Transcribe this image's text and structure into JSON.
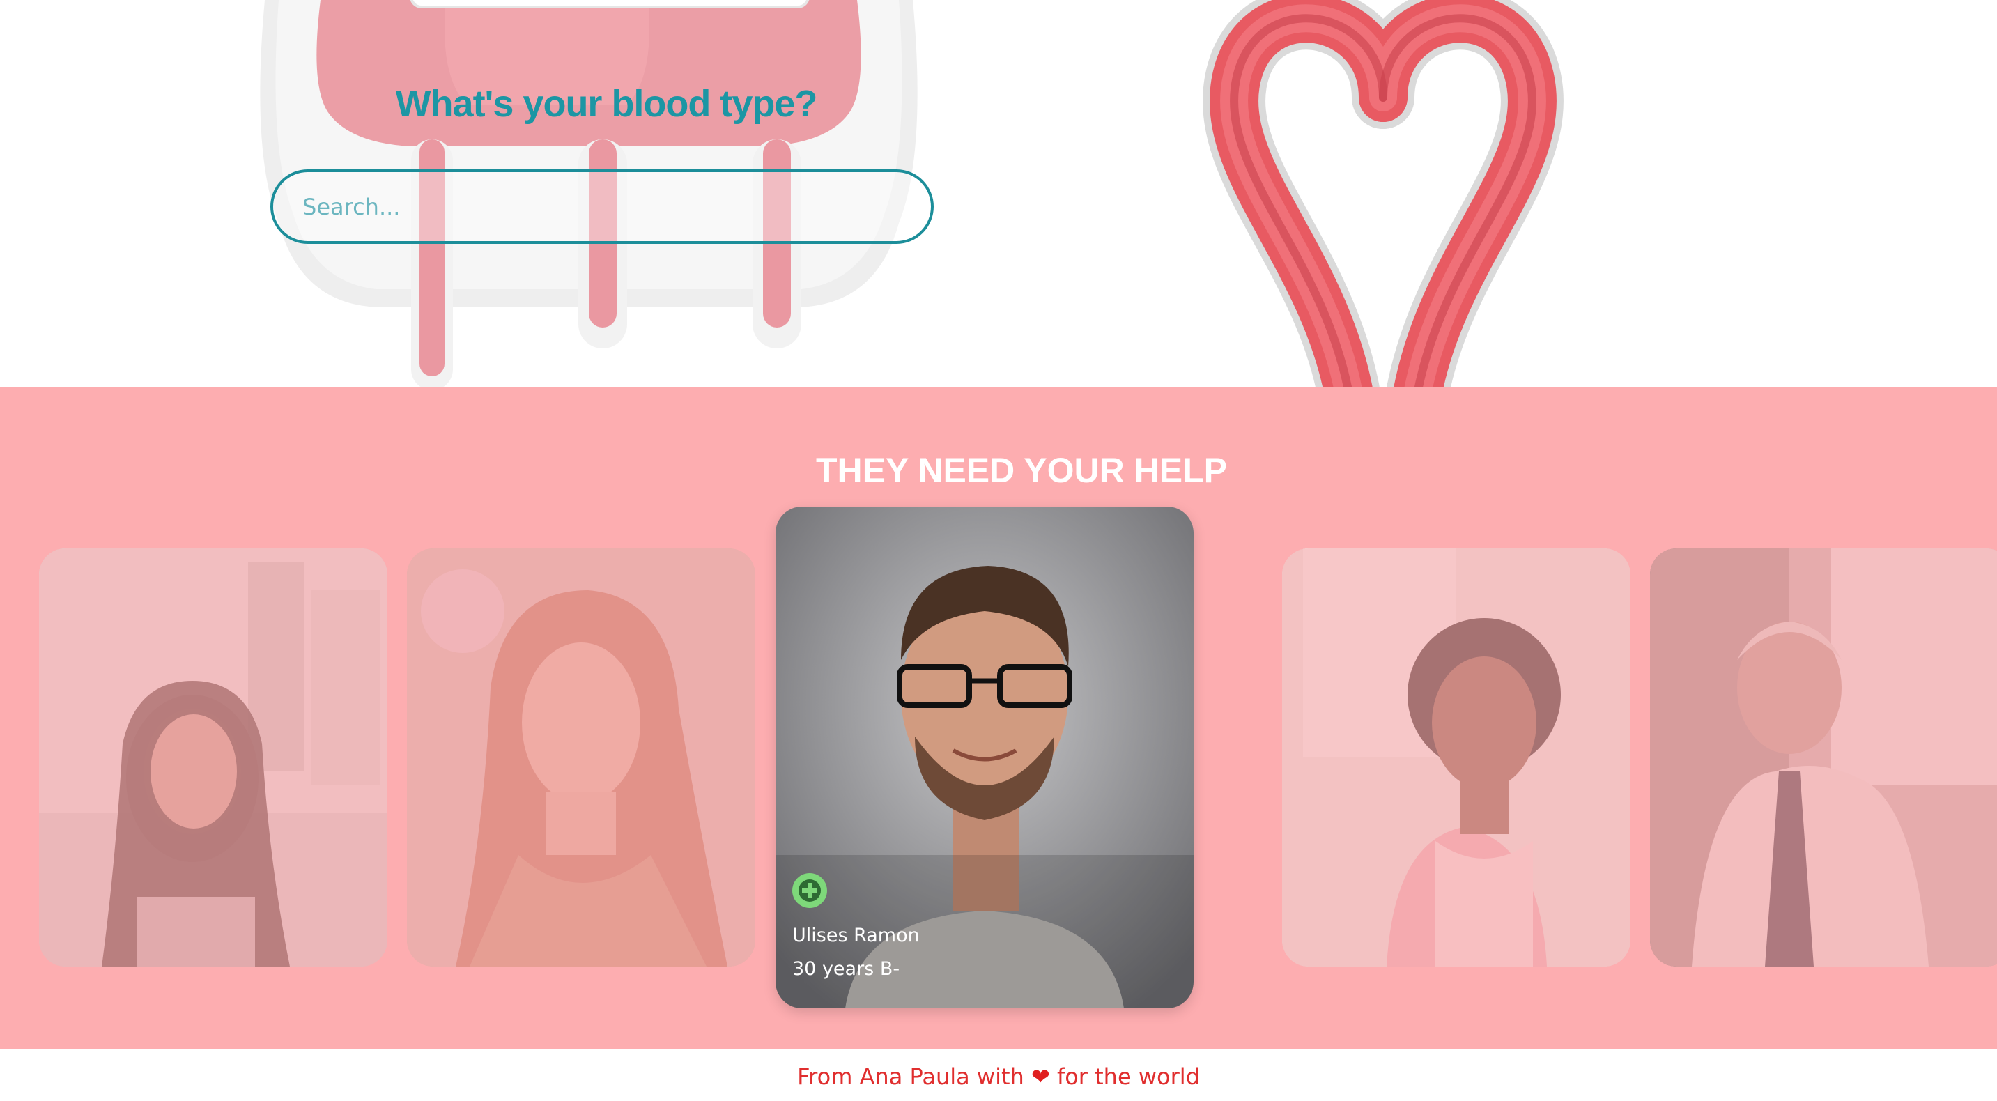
{
  "hero": {
    "title": "What's your blood type?",
    "search_placeholder": "Search..."
  },
  "help": {
    "title": "THEY NEED YOUR HELP",
    "cards": [
      {
        "photo": "young-woman-with-glasses"
      },
      {
        "photo": "woman-long-hair"
      },
      {
        "photo": "smiling-man-with-glasses",
        "name": "Ulises Ramon",
        "info": "30 years B-",
        "action_icon": "plus-icon"
      },
      {
        "photo": "woman-curly-hair-glasses"
      },
      {
        "photo": "older-man-tie"
      }
    ]
  },
  "footer": {
    "prefix": "From Ana Paula with",
    "heart": "❤",
    "suffix": "for the world"
  },
  "colors": {
    "accent": "#1c96a4",
    "section_bg": "#fdadb0",
    "heart_red": "#e02e2e",
    "add_green": "#7ed87a"
  }
}
